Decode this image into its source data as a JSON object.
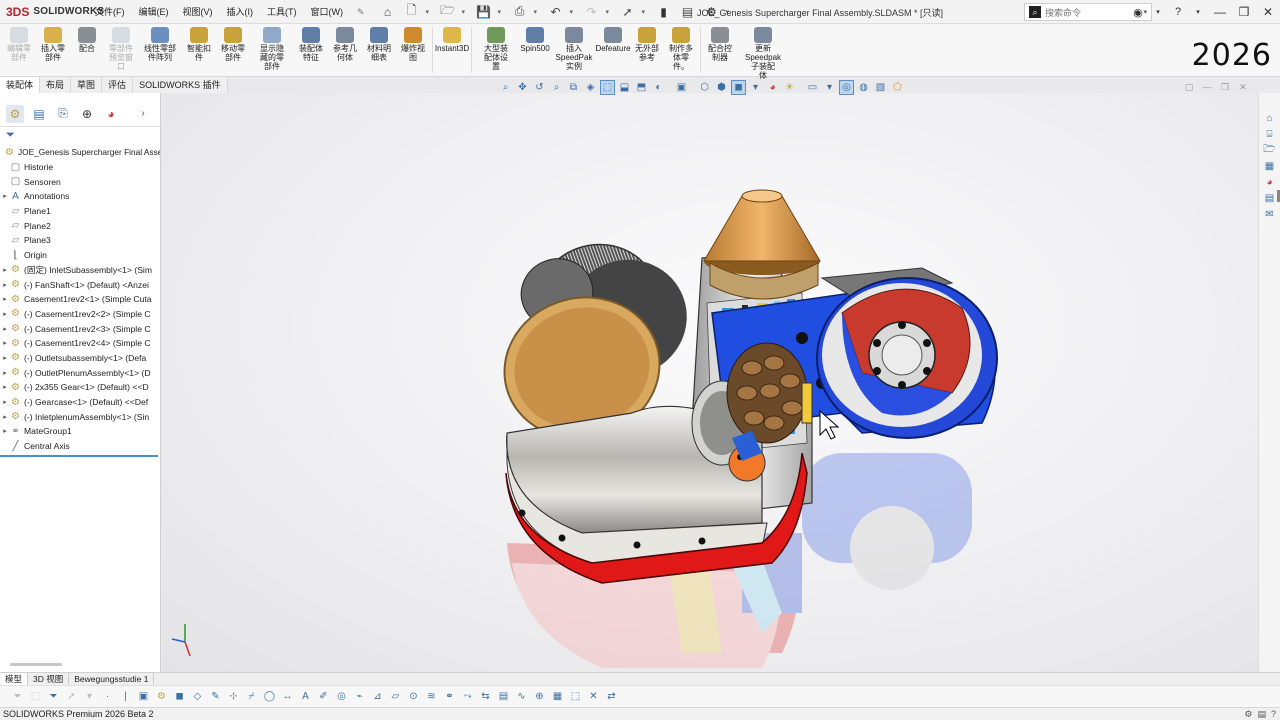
{
  "app": {
    "brand_prefix": "3DS",
    "brand_name": "SOLIDWORKS",
    "doc_title": "JOE_Genesis Supercharger Final Assembly.SLDASM * [只读]",
    "watermark_year": "2026"
  },
  "menu": [
    "文件(F)",
    "编辑(E)",
    "视图(V)",
    "插入(I)",
    "工具(T)",
    "窗口(W)"
  ],
  "search": {
    "placeholder": "搜索命令"
  },
  "commands": [
    {
      "label": "编辑零\n部件",
      "enabled": false,
      "color": "#9aa9bb"
    },
    {
      "label": "插入零\n部件",
      "enabled": true,
      "color": "#d9b04b"
    },
    {
      "label": "配合",
      "enabled": true,
      "color": "#8a8f96"
    },
    {
      "label": "零部件\n预览窗\n口",
      "enabled": false,
      "color": "#9aa9bb"
    },
    {
      "label": "线性零部\n件阵列",
      "enabled": true,
      "color": "#6d8fbf"
    },
    {
      "label": "智能扣\n件",
      "enabled": true,
      "color": "#c9a23c"
    },
    {
      "label": "移动零\n部件",
      "enabled": true,
      "color": "#c9a23c"
    },
    {
      "label": "显示隐\n藏的零\n部件",
      "enabled": true,
      "color": "#8fa9c7"
    },
    {
      "label": "装配体\n特征",
      "enabled": true,
      "color": "#5f7fa8"
    },
    {
      "label": "参考几\n何体",
      "enabled": true,
      "color": "#7a8a9c"
    },
    {
      "label": "材料明\n细表",
      "enabled": true,
      "color": "#5f7fa8"
    },
    {
      "label": "爆炸视\n图",
      "enabled": true,
      "color": "#d08a2e"
    },
    {
      "label": "Instant3D",
      "enabled": true,
      "color": "#e0b84a"
    },
    {
      "label": "大型装\n配体设\n置",
      "enabled": true,
      "color": "#6d9a5a"
    },
    {
      "label": "Spin500",
      "enabled": true,
      "color": "#5f7fa8"
    },
    {
      "label": "插入\nSpeedPak\n实例",
      "enabled": true,
      "color": "#7a8a9c"
    },
    {
      "label": "Defeature",
      "enabled": true,
      "color": "#7a8a9c"
    },
    {
      "label": "无外部\n参考",
      "enabled": true,
      "color": "#c9a23c"
    },
    {
      "label": "制作多\n体零\n件。",
      "enabled": true,
      "color": "#c9a23c"
    },
    {
      "label": "配合控\n制器",
      "enabled": true,
      "color": "#8a8f96"
    },
    {
      "label": "更新\nSpeedpak\n子装配\n体",
      "enabled": true,
      "color": "#7a8a9c"
    }
  ],
  "cmd_tabs": [
    "装配体",
    "布局",
    "草图",
    "评估",
    "SOLIDWORKS 插件"
  ],
  "tree": [
    {
      "label": "JOE_Genesis Supercharger Final Asse",
      "icon": "assembly",
      "expander": false,
      "root": true
    },
    {
      "label": "Historie",
      "icon": "history-folder",
      "expander": false
    },
    {
      "label": "Sensoren",
      "icon": "sensor",
      "expander": false
    },
    {
      "label": "Annotations",
      "icon": "annotation",
      "expander": true
    },
    {
      "label": "Plane1",
      "icon": "plane",
      "expander": false
    },
    {
      "label": "Plane2",
      "icon": "plane",
      "expander": false
    },
    {
      "label": "Plane3",
      "icon": "plane",
      "expander": false
    },
    {
      "label": "Origin",
      "icon": "origin",
      "expander": false
    },
    {
      "label": "(固定) InletSubassembly<1> (Sim",
      "icon": "subassembly",
      "expander": true
    },
    {
      "label": "(-) FanShaft<1> (Default) <Anzei",
      "icon": "subassembly",
      "expander": true
    },
    {
      "label": "Casement1rev2<1> (Simple Cuta",
      "icon": "subassembly",
      "expander": true
    },
    {
      "label": "(-) Casement1rev2<2> (Simple C",
      "icon": "subassembly",
      "expander": true
    },
    {
      "label": "(-) Casement1rev2<3> (Simple C",
      "icon": "subassembly",
      "expander": true
    },
    {
      "label": "(-) Casement1rev2<4> (Simple C",
      "icon": "subassembly",
      "expander": true
    },
    {
      "label": "(-) Outletsubassembly<1> (Defa",
      "icon": "subassembly",
      "expander": true
    },
    {
      "label": "(-) OutletPlenumAssembly<1> (D",
      "icon": "subassembly",
      "expander": true
    },
    {
      "label": "(-) 2x355 Gear<1> (Default) <<D",
      "icon": "subassembly",
      "expander": true
    },
    {
      "label": "(-) Gearcase<1> (Default) <<Def",
      "icon": "subassembly",
      "expander": true
    },
    {
      "label": "(-) InletplenumAssembly<1> (Sin",
      "icon": "subassembly",
      "expander": true
    },
    {
      "label": "MateGroup1",
      "icon": "mates",
      "expander": true
    },
    {
      "label": "Central Axis",
      "icon": "axis",
      "expander": false
    }
  ],
  "bottom_tabs": [
    "模型",
    "3D 视图",
    "Bewegungsstudie 1"
  ],
  "status": {
    "text": "SOLIDWORKS Premium 2026 Beta 2"
  }
}
